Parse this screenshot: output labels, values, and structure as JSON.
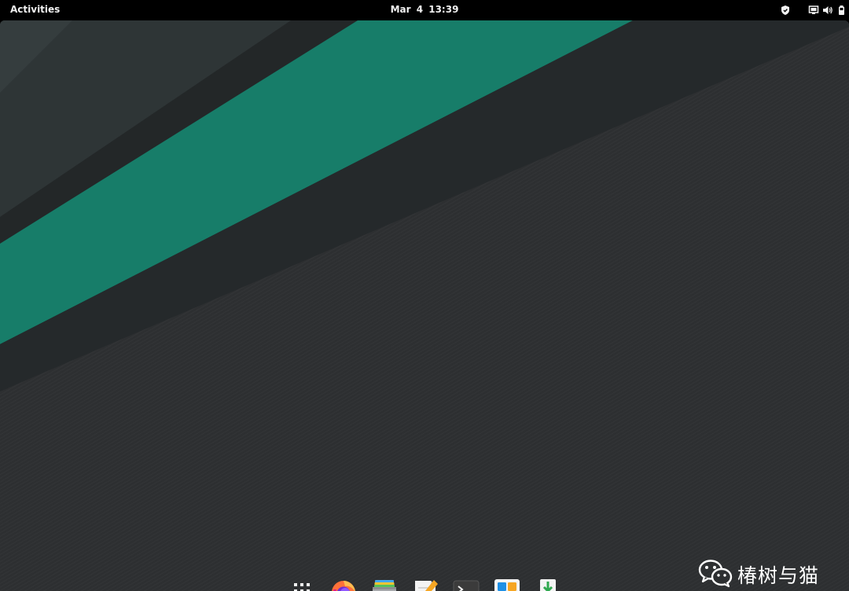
{
  "topbar": {
    "activities_label": "Activities",
    "clock": "Mar 4  13:39",
    "status_icons": [
      "shield-icon",
      "network-icon",
      "volume-icon",
      "battery-icon"
    ]
  },
  "wallpaper": {
    "colors": {
      "teal": "#177d69",
      "dark": "#232728",
      "slate": "#2e3536",
      "slate_light": "#333b3c",
      "background": "#2d2f31"
    }
  },
  "dock": {
    "items": [
      {
        "icon": "app-grid-icon",
        "name": "Show Applications"
      },
      {
        "icon": "firefox-icon",
        "name": "Firefox"
      },
      {
        "icon": "files-icon",
        "name": "Files"
      },
      {
        "icon": "text-editor-icon",
        "name": "Text Editor"
      },
      {
        "icon": "terminal-icon",
        "name": "Terminal"
      },
      {
        "icon": "software-icon",
        "name": "Software"
      },
      {
        "icon": "installer-icon",
        "name": "Install"
      }
    ]
  },
  "watermark": {
    "text": "椿树与猫"
  }
}
